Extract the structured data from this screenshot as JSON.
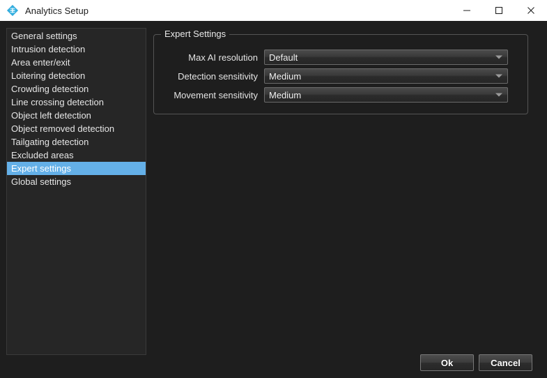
{
  "window": {
    "title": "Analytics Setup",
    "app_icon": "analytics-diamond-icon",
    "controls": {
      "minimize": "—",
      "maximize": "□",
      "close": "✕"
    }
  },
  "sidebar": {
    "items": [
      {
        "label": "General settings",
        "selected": false
      },
      {
        "label": "Intrusion detection",
        "selected": false
      },
      {
        "label": "Area enter/exit",
        "selected": false
      },
      {
        "label": "Loitering detection",
        "selected": false
      },
      {
        "label": "Crowding detection",
        "selected": false
      },
      {
        "label": "Line crossing detection",
        "selected": false
      },
      {
        "label": "Object left detection",
        "selected": false
      },
      {
        "label": "Object removed detection",
        "selected": false
      },
      {
        "label": "Tailgating detection",
        "selected": false
      },
      {
        "label": "Excluded areas",
        "selected": false
      },
      {
        "label": "Expert settings",
        "selected": true
      },
      {
        "label": "Global settings",
        "selected": false
      }
    ]
  },
  "expert_settings": {
    "group_title": "Expert Settings",
    "fields": [
      {
        "label": "Max AI resolution",
        "value": "Default"
      },
      {
        "label": "Detection sensitivity",
        "value": "Medium"
      },
      {
        "label": "Movement sensitivity",
        "value": "Medium"
      }
    ]
  },
  "footer": {
    "ok_label": "Ok",
    "cancel_label": "Cancel"
  },
  "colors": {
    "titlebar_bg": "#ffffff",
    "dialog_bg": "#1e1e1e",
    "list_bg": "#262626",
    "selection_blue": "#64b0e8",
    "text": "#e6e6e6",
    "border": "#555555"
  }
}
